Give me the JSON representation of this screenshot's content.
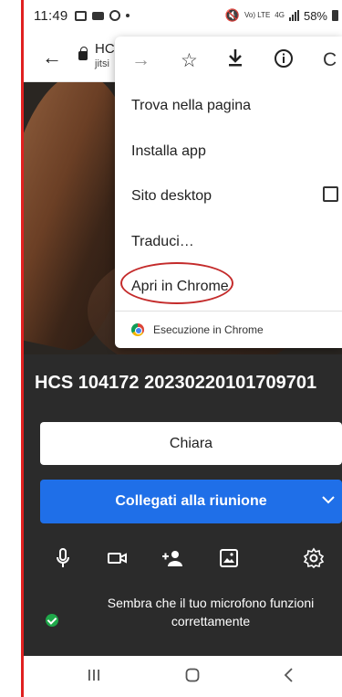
{
  "status": {
    "time": "11:49",
    "network_label": "Vo) LTE",
    "network_type": "4G",
    "battery": "58%"
  },
  "urlbar": {
    "title": "HC",
    "host": "jitsi"
  },
  "menu": {
    "items": [
      {
        "label": "Trova nella pagina"
      },
      {
        "label": "Installa app"
      },
      {
        "label": "Sito desktop"
      },
      {
        "label": "Traduci…"
      },
      {
        "label": "Apri in Chrome"
      }
    ],
    "footer": "Esecuzione in Chrome"
  },
  "meeting": {
    "title": "HCS 104172 20230220101709701"
  },
  "prejoin": {
    "name_value": "Chiara",
    "join_label": "Collegati alla riunione",
    "mic_message": "Sembra che il tuo microfono funzioni correttamente"
  },
  "colors": {
    "join_button": "#1f6fe8",
    "panel_bg": "#2b2b2b",
    "ok_indicator": "#1fa84a",
    "highlight_ellipse": "#c42b2b"
  }
}
